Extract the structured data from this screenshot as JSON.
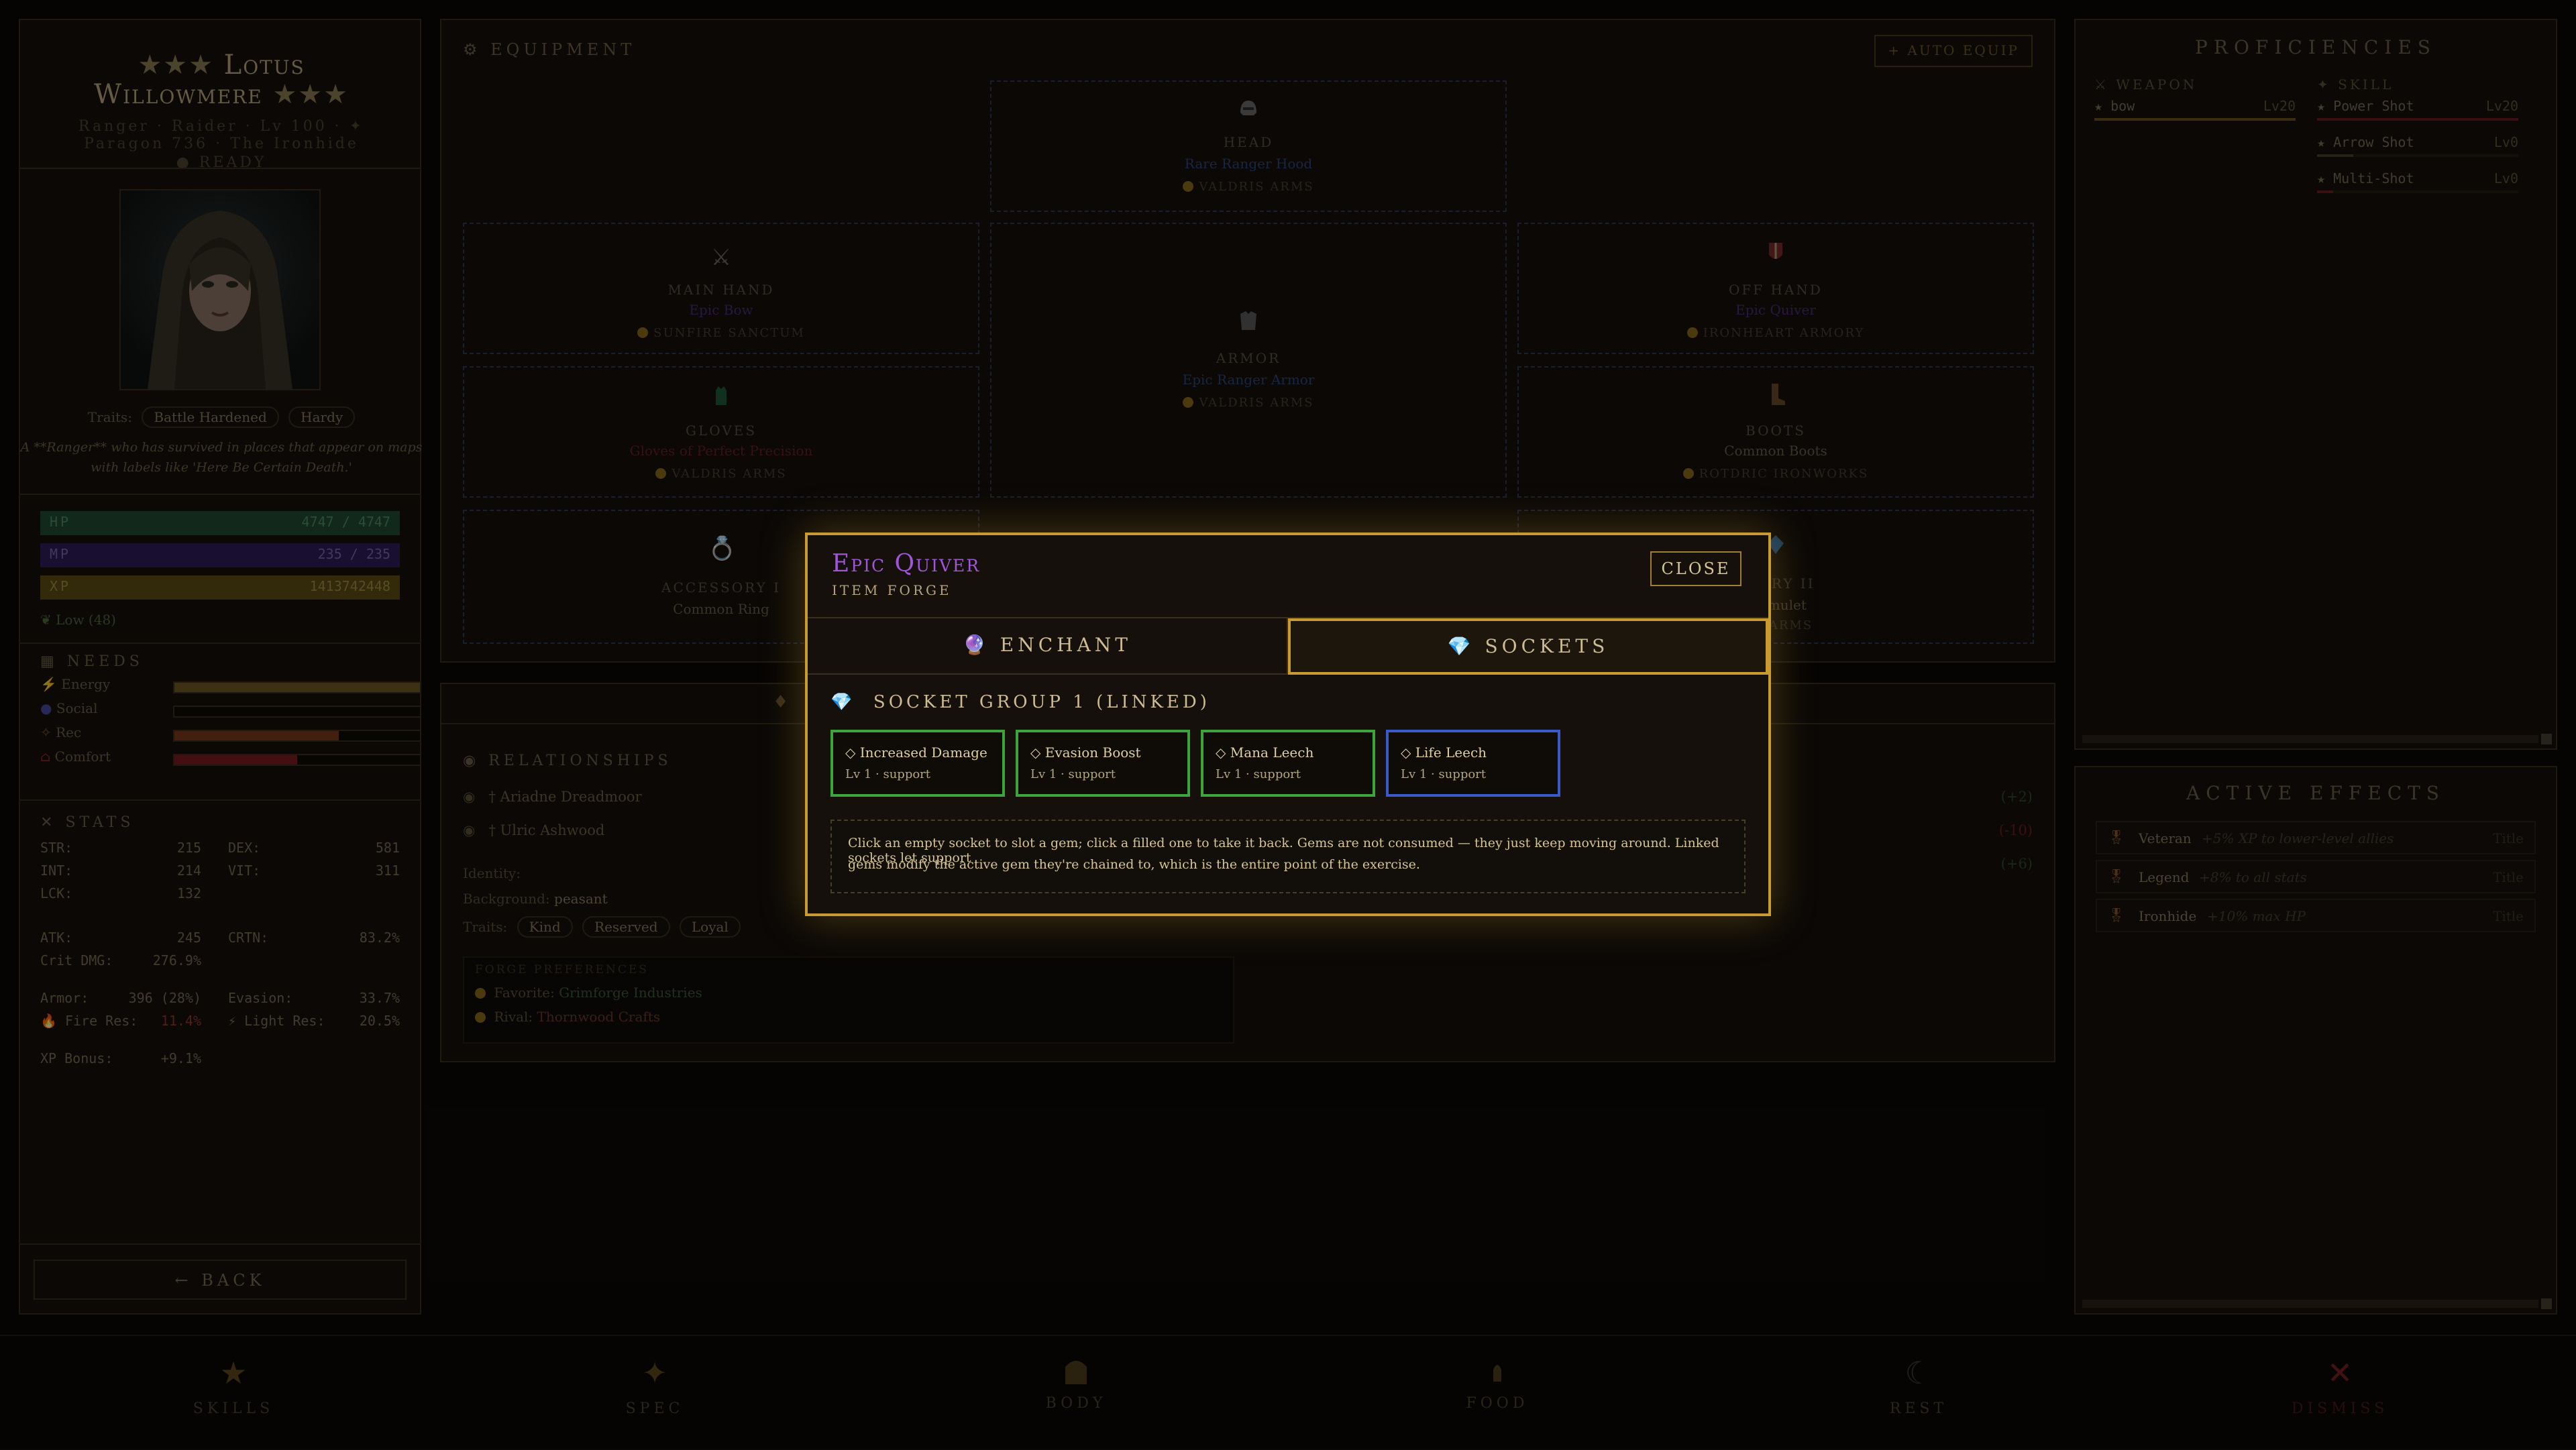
{
  "character": {
    "name_line1": "Lotus",
    "name_line2": "Willowmere",
    "subtitle_line1": "Ranger · Raider · Lv 100 · ✦",
    "subtitle_line2": "Paragon 736 · The Ironhide",
    "status": "● READY",
    "traits_label": "Traits:",
    "traits": [
      "Battle Hardened",
      "Hardy"
    ],
    "bio_line1": "A **Ranger** who has survived in places that appear on maps",
    "bio_line2": "with labels like 'Here Be Certain Death.'",
    "hp_label": "HP",
    "hp_value": "4747 / 4747",
    "mp_label": "MP",
    "mp_value": "235 / 235",
    "xp_label": "XP",
    "xp_value": "1413742448",
    "morale": "Low (48)",
    "needs_title": "Needs",
    "needs": [
      {
        "label": "Energy",
        "fill": 1.0,
        "color": "#6e5a22"
      },
      {
        "label": "Social",
        "fill": 0.0,
        "color": "#3a3a80"
      },
      {
        "label": "Rec",
        "fill": 0.67,
        "color": "#7a3a1c"
      },
      {
        "label": "Comfort",
        "fill": 0.5,
        "color": "#7a1c22"
      }
    ],
    "stats_title": "Stats",
    "stats": {
      "str_l": "STR:",
      "str_v": "215",
      "dex_l": "DEX:",
      "dex_v": "581",
      "int_l": "INT:",
      "int_v": "214",
      "vit_l": "VIT:",
      "vit_v": "311",
      "lck_l": "LCK:",
      "lck_v": "132",
      "atk_l": "ATK:",
      "atk_v": "245",
      "crtn_l": "CRTN:",
      "crtn_v": "83.2%",
      "critdmg_l": "Crit DMG:",
      "critdmg_v": "276.9%",
      "armor_l": "Armor:",
      "armor_v": "396 (28%)",
      "evasion_l": "Evasion:",
      "evasion_v": "33.7%",
      "fireres_l": "Fire Res:",
      "fireres_v": "11.4%",
      "lightres_l": "Light Res:",
      "lightres_v": "20.5%",
      "xpbonus_l": "XP Bonus:",
      "xpbonus_v": "+9.1%"
    },
    "back_label": "← BACK"
  },
  "equipment": {
    "title": "Equipment",
    "auto_equip": "+ AUTO EQUIP",
    "slots": {
      "head": {
        "name": "Head",
        "item": "Rare Ranger Hood",
        "maker": "Valdris Arms"
      },
      "mainhand": {
        "name": "Main Hand",
        "item": "Epic Bow",
        "maker": "Sunfire Sanctum"
      },
      "armor": {
        "name": "Armor",
        "item": "Epic Ranger Armor",
        "maker": "Valdris Arms"
      },
      "offhand": {
        "name": "Off Hand",
        "item": "Epic Quiver",
        "maker": "Ironheart Armory"
      },
      "gloves": {
        "name": "Gloves",
        "item": "Gloves of Perfect Precision",
        "maker": "Valdris Arms"
      },
      "boots": {
        "name": "Boots",
        "item": "Common Boots",
        "maker": "Rotdric Ironworks"
      },
      "acc1": {
        "name": "Accessory I",
        "item": "Common Ring"
      },
      "acc2": {
        "name": "ssory II",
        "item": "n Amulet",
        "maker": "lis Arms"
      }
    }
  },
  "relationships": {
    "title": "Relationships",
    "people": [
      {
        "name": "† Ariadne Dreadmoor",
        "delta": "(+2)"
      },
      {
        "name": "† Ulric Ashwood",
        "delta": "(-10)"
      }
    ],
    "extra_delta": "(+6)",
    "identity_label": "Identity:",
    "background_label": "Background:",
    "background_value": "peasant",
    "traits_label": "Traits:",
    "traits": [
      "Kind",
      "Reserved",
      "Loyal"
    ],
    "forge_title": "Forge Preferences",
    "favorite_label": "Favorite:",
    "favorite_value": "Grimforge Industries",
    "rival_label": "Rival:",
    "rival_value": "Thornwood Crafts"
  },
  "proficiencies": {
    "title": "Proficiencies",
    "weapon_header": "⚔ WEAPON",
    "skill_header": "✦ SKILL",
    "weapons": [
      {
        "name": "★ bow",
        "level": "Lv20"
      }
    ],
    "skills": [
      {
        "name": "★ Power Shot",
        "level": "Lv20"
      },
      {
        "name": "★ Arrow Shot",
        "level": "Lv0"
      },
      {
        "name": "★ Multi-Shot",
        "level": "Lv0"
      }
    ]
  },
  "effects": {
    "title": "Active Effects",
    "items": [
      {
        "name": "Veteran",
        "desc": "+5% XP to lower-level allies",
        "tag": "Title"
      },
      {
        "name": "Legend",
        "desc": "+8% to all stats",
        "tag": "Title"
      },
      {
        "name": "Ironhide",
        "desc": "+10% max HP",
        "tag": "Title"
      }
    ]
  },
  "bottom_nav": [
    "Skills",
    "Spec",
    "Body",
    "Food",
    "Rest",
    "Dismiss"
  ],
  "modal": {
    "title": "Epic Quiver",
    "subtitle": "Item Forge",
    "close": "CLOSE",
    "tab_enchant": "Enchant",
    "tab_sockets": "Sockets",
    "group_title": "Socket Group 1 (Linked)",
    "gems": [
      {
        "name": "◇ Increased Damage",
        "level": "Lv 1 · support"
      },
      {
        "name": "◇ Evasion Boost",
        "level": "Lv 1 · support"
      },
      {
        "name": "◇ Mana Leech",
        "level": "Lv 1 · support"
      },
      {
        "name": "◇ Life Leech",
        "level": "Lv 1 · support"
      }
    ],
    "help_line1": "Click an empty socket to slot a gem; click a filled one to take it back. Gems are not consumed — they just keep moving around. Linked sockets let support",
    "help_line2": "gems modify the active gem they're chained to, which is the entire point of the exercise."
  },
  "colors": {
    "gold": "#c99a2e",
    "epic": "#8a46c8",
    "rare": "#3a5aa8",
    "hp": "#1f5a36",
    "mp": "#3a1f6e",
    "xp": "#7a6418",
    "green_socket": "#3fa33c",
    "blue_socket": "#3a5ac8"
  }
}
